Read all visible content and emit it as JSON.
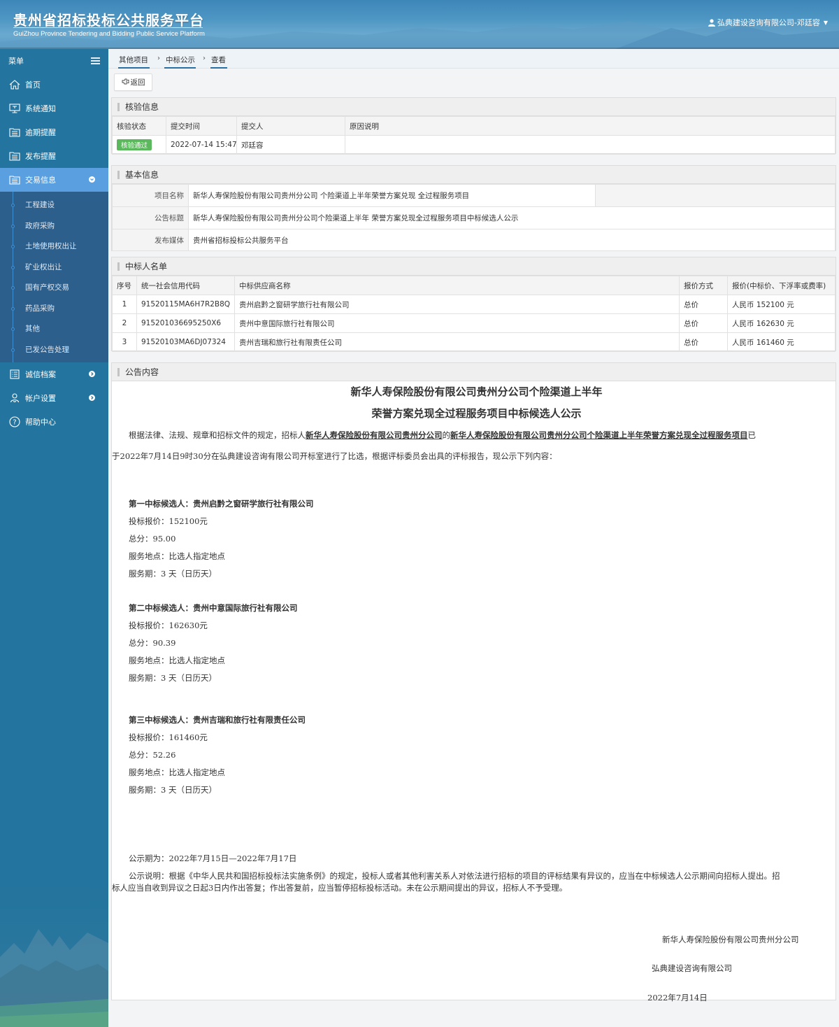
{
  "header": {
    "title_cn": "贵州省招标投标公共服务平台",
    "title_en": "GuiZhou Province Tendering and Bidding Public Service Platform",
    "user": "弘典建设咨询有限公司-邓廷容",
    "user_icon": "user-icon"
  },
  "sidebar": {
    "menu_label": "菜单",
    "items": [
      {
        "label": "首页",
        "icon": "home-icon"
      },
      {
        "label": "系统通知",
        "icon": "monitor-icon"
      },
      {
        "label": "逾期提醒",
        "icon": "folder-list-icon"
      },
      {
        "label": "发布提醒",
        "icon": "folder-list-icon"
      },
      {
        "label": "交易信息",
        "icon": "folder-list-icon",
        "active": true,
        "expanded": true
      }
    ],
    "subitems": [
      "工程建设",
      "政府采购",
      "土地使用权出让",
      "矿业权出让",
      "国有产权交易",
      "药品采购",
      "其他",
      "已发公告处理"
    ],
    "bottom_items": [
      {
        "label": "诚信档案",
        "icon": "list-icon"
      },
      {
        "label": "帐户设置",
        "icon": "user-outline-icon"
      },
      {
        "label": "帮助中心",
        "icon": "help-icon"
      }
    ]
  },
  "breadcrumb": [
    "其他项目",
    "中标公示",
    "查看"
  ],
  "toolbar": {
    "back_label": "返回"
  },
  "verify": {
    "title": "核验信息",
    "headers": [
      "核验状态",
      "提交时间",
      "提交人",
      "原因说明"
    ],
    "row": {
      "status": "核验通过",
      "time": "2022-07-14 15:47",
      "submitter": "邓廷容",
      "reason": ""
    },
    "status_color": "#5cb85c"
  },
  "basic": {
    "title": "基本信息",
    "rows": [
      {
        "label": "项目名称",
        "value": "新华人寿保险股份有限公司贵州分公司 个险渠道上半年荣誉方案兑现 全过程服务项目"
      },
      {
        "label": "公告标题",
        "value": "新华人寿保险股份有限公司贵州分公司个险渠道上半年 荣誉方案兑现全过程服务项目中标候选人公示"
      },
      {
        "label": "发布媒体",
        "value": "贵州省招标投标公共服务平台"
      }
    ]
  },
  "winners": {
    "title": "中标人名单",
    "headers": [
      "序号",
      "统一社会信用代码",
      "中标供应商名称",
      "报价方式",
      "报价(中标价、下浮率或费率)"
    ],
    "rows": [
      {
        "no": "1",
        "code": "91520115MA6H7R2B8Q",
        "name": "贵州启黔之窗研学旅行社有限公司",
        "method": "总价",
        "price": "人民币 152100 元"
      },
      {
        "no": "2",
        "code": "915201036695250X6",
        "name": "贵州中意国际旅行社有限公司",
        "method": "总价",
        "price": "人民币 162630 元"
      },
      {
        "no": "3",
        "code": "91520103MA6DJ07324",
        "name": "贵州吉瑞和旅行社有限责任公司",
        "method": "总价",
        "price": "人民币 161460 元"
      }
    ]
  },
  "announcement": {
    "title": "公告内容",
    "heading_line1": "新华人寿保险股份有限公司贵州分公司个险渠道上半年",
    "heading_line2": "荣誉方案兑现全过程服务项目中标候选人公示",
    "intro_prefix": "根据法律、法规、规章和招标文件的规定，招标人",
    "intro_tenderer": "新华人寿保险股份有限公司贵州分公司",
    "intro_of": "的",
    "intro_project": "新华人寿保险股份有限公司贵州分公司个险渠道上半年荣誉方案兑现全过程服务项目",
    "intro_suffix": "已",
    "intro_line2": "于2022年7月14日9时30分在弘典建设咨询有限公司开标室进行了比选，根据评标委员会出具的评标报告，现公示下列内容：",
    "candidates": [
      {
        "heading": "第一中标候选人：贵州启黔之窗研学旅行社有限公司",
        "price": "投标报价：152100元",
        "score": "总分：95.00",
        "location": "服务地点：比选人指定地点",
        "period": "服务期：3 天（日历天）"
      },
      {
        "heading": "第二中标候选人：贵州中意国际旅行社有限公司",
        "price": "投标报价：162630元",
        "score": "总分：90.39",
        "location": "服务地点：比选人指定地点",
        "period": "服务期：3 天（日历天）"
      },
      {
        "heading": "第三中标候选人：贵州吉瑞和旅行社有限责任公司",
        "price": "投标报价：161460元",
        "score": "总分：52.26",
        "location": "服务地点：比选人指定地点",
        "period": "服务期：3 天（日历天）"
      }
    ],
    "period": "公示期为：2022年7月15日—2022年7月17日",
    "note_line1": "公示说明：根据《中华人民共和国招标投标法实施条例》的规定，投标人或者其他利害关系人对依法进行招标的项目的评标结果有异议的，应当在中标候选人公示期间向招标人提出。招",
    "note_line2": "标人应当自收到异议之日起3日内作出答复；作出答复前，应当暂停招标投标活动。未在公示期间提出的异议，招标人不予受理。",
    "signer1": "新华人寿保险股份有限公司贵州分公司",
    "signer2": "弘典建设咨询有限公司",
    "date": "2022年7月14日"
  }
}
